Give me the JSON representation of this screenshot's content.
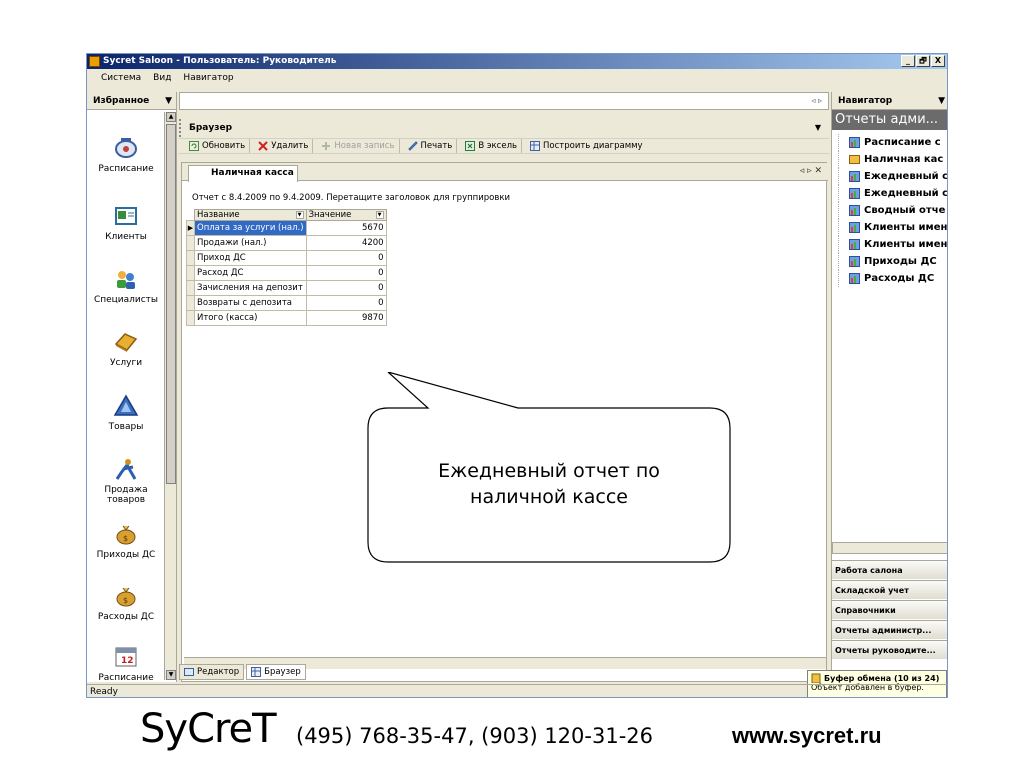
{
  "window": {
    "title": "Sycret Saloon - Пользователь: Руководитель",
    "min_label": "_",
    "max_label": "🗗",
    "close_label": "X"
  },
  "menu": [
    "Система",
    "Вид",
    "Навигатор"
  ],
  "left_panel": {
    "header": "Избранное",
    "items": [
      {
        "label": "Расписание",
        "icon": "calendar-icon"
      },
      {
        "label": "Клиенты",
        "icon": "clients-icon"
      },
      {
        "label": "Специалисты",
        "icon": "specialists-icon"
      },
      {
        "label": "Услуги",
        "icon": "services-icon"
      },
      {
        "label": "Товары",
        "icon": "goods-icon"
      },
      {
        "label": "Продажа товаров",
        "icon": "sales-icon"
      },
      {
        "label": "Приходы ДС",
        "icon": "money-in-icon"
      },
      {
        "label": "Расходы ДС",
        "icon": "money-out-icon"
      },
      {
        "label": "Расписание",
        "icon": "schedule-calendar-icon"
      }
    ]
  },
  "browser": {
    "header": "Браузер",
    "toolbar": {
      "refresh": "Обновить",
      "delete": "Удалить",
      "new_record": "Новая запись",
      "print": "Печать",
      "excel": "В эксель",
      "chart": "Построить диаграмму"
    },
    "doc_tab": "Наличная касса",
    "doc_ctrls": "◃ ▹ ✕",
    "report_info": "Отчет с 8.4.2009 по 9.4.2009. Перетащите заголовок для группировки",
    "columns": [
      "Название",
      "Значение"
    ],
    "rows": [
      {
        "name": "Оплата за услуги (нал.)",
        "value": "5670"
      },
      {
        "name": "Продажи (нал.)",
        "value": "4200"
      },
      {
        "name": "Приход ДС",
        "value": "0"
      },
      {
        "name": "Расход ДС",
        "value": "0"
      },
      {
        "name": "Зачисления на депозит",
        "value": "0"
      },
      {
        "name": "Возвраты с депозита",
        "value": "0"
      },
      {
        "name": "Итого (касса)",
        "value": "9870"
      }
    ]
  },
  "bottom_tabs": [
    "Редактор",
    "Браузер"
  ],
  "status": "Ready",
  "right_panel": {
    "header": "Навигатор",
    "title": "Отчеты адми...",
    "tree": [
      "Расписание с",
      "Наличная кас",
      "Ежедневный с",
      "Ежедневный с",
      "Сводный отче",
      "Клиенты имен",
      "Клиенты имен",
      "Приходы ДС",
      "Расходы ДС"
    ],
    "categories": [
      "Работа салона",
      "Складской учет",
      "Справочники",
      "Отчеты администр...",
      "Отчеты руководите..."
    ]
  },
  "clipboard": {
    "title": "Буфер обмена (10 из 24)",
    "message": "Объект добавлен в буфер."
  },
  "callout": {
    "line1": "Ежедневный отчет по",
    "line2": "наличной кассе"
  },
  "footer": {
    "logo": "SyCreT",
    "phone": "(495) 768-35-47, (903) 120-31-26",
    "site": "www.sycret.ru"
  }
}
